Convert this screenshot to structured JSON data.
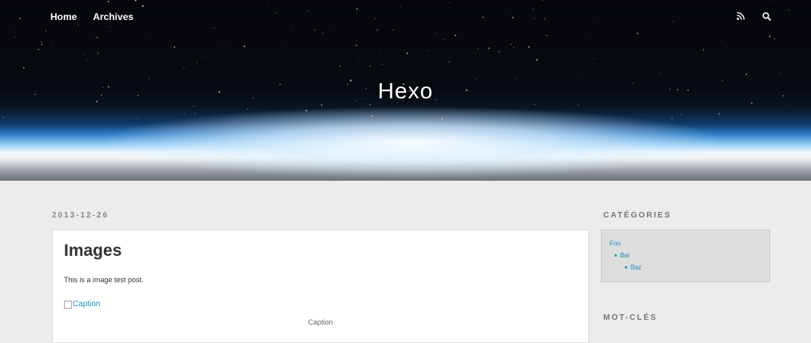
{
  "header": {
    "nav": [
      "Home",
      "Archives"
    ],
    "site_title": "Hexo",
    "icons": [
      "rss-icon",
      "search-icon"
    ]
  },
  "post": {
    "date": "2013-12-26",
    "title": "Images",
    "body": "This is a image test post.",
    "image_alt": "Caption",
    "caption": "Caption"
  },
  "sidebar": {
    "categories_title": "CATÉGORIES",
    "categories": {
      "root": "Foo",
      "child": "Bar",
      "grandchild": "Baz"
    },
    "tags_title": "MOT-CLÉS"
  },
  "colors": {
    "link": "#258fb8",
    "page_bg": "#ececec"
  }
}
